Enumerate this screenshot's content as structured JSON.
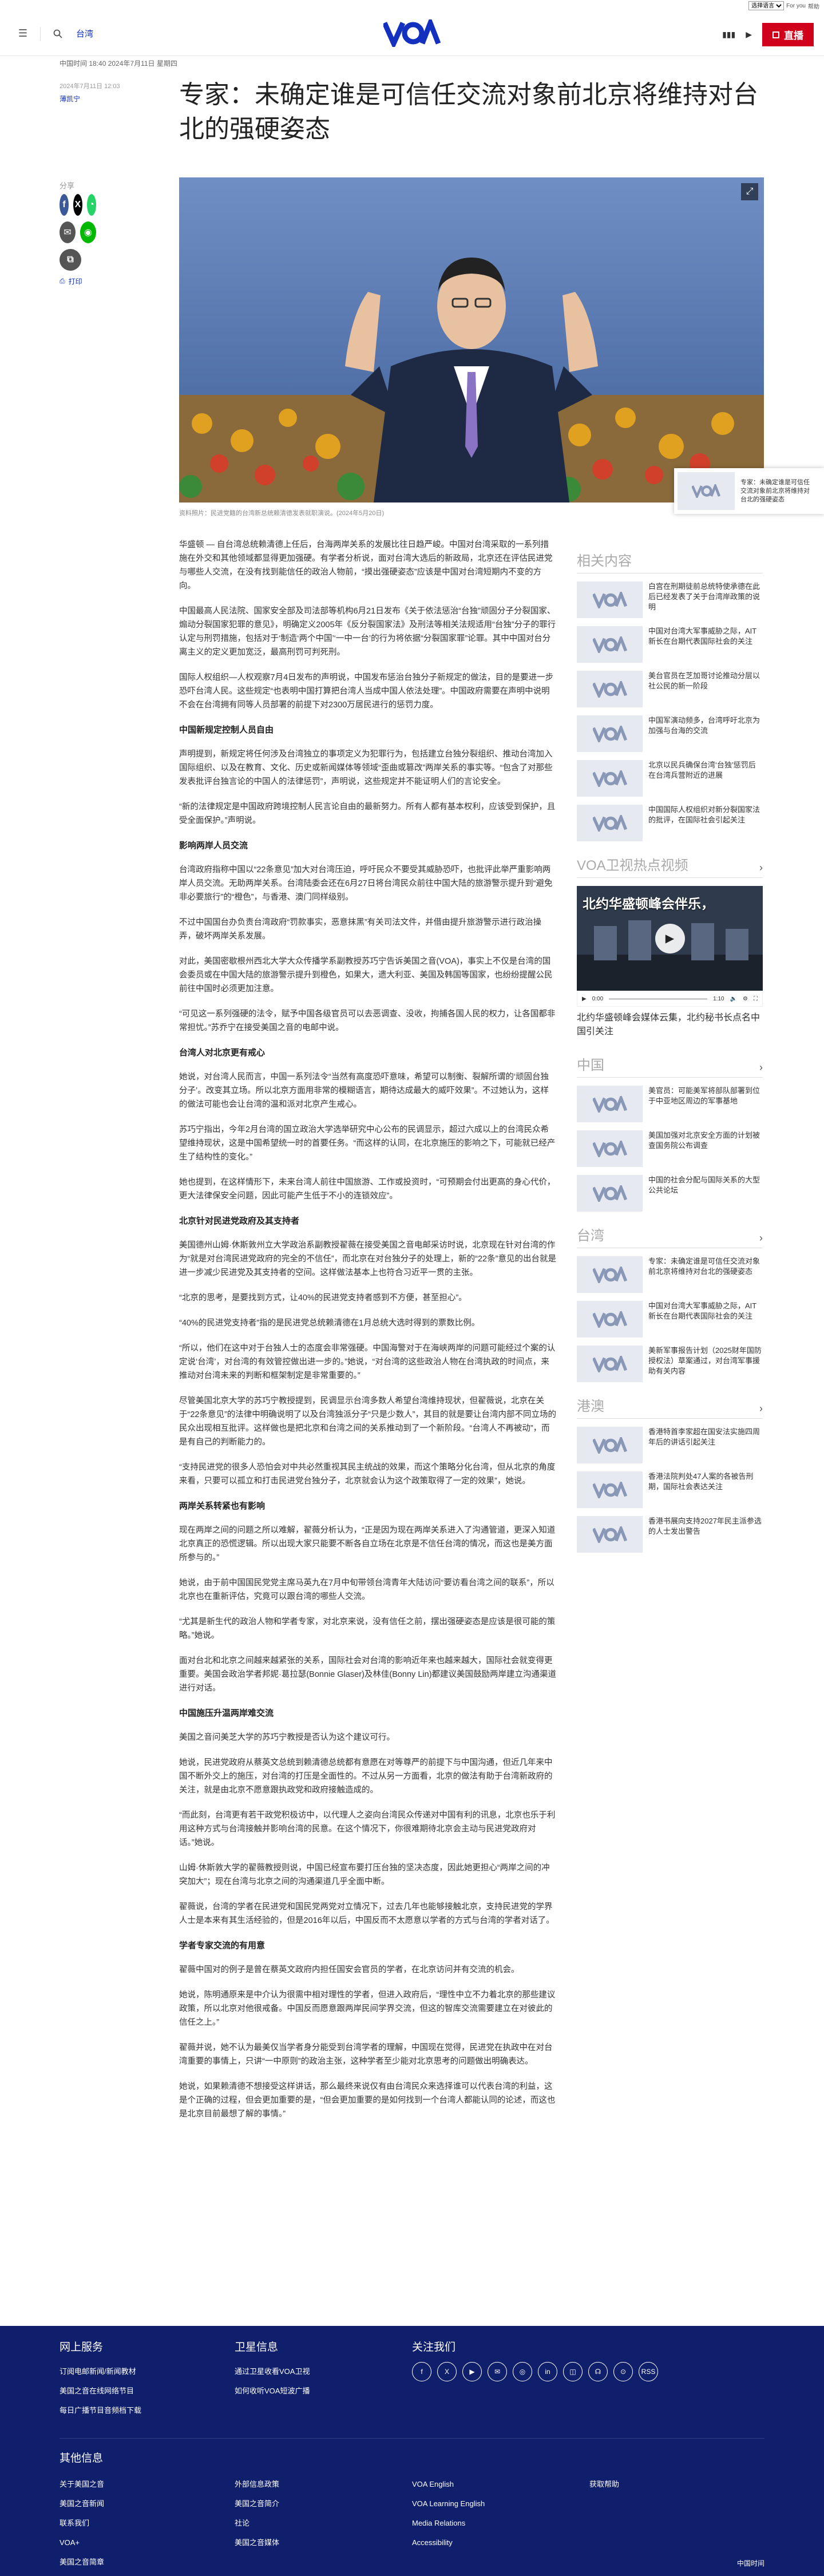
{
  "top_strip": {
    "select_value": "选择语言",
    "links": [
      "For you",
      "帮助"
    ]
  },
  "nav": {
    "section_link": "台湾",
    "logo_text": "VOA",
    "live_label": "直播"
  },
  "article": {
    "dateline": "中国时间 18:40 2024年7月11日 星期四",
    "timestamp": "2024年7月11日 12:03",
    "author": "薄凯宁",
    "title": "专家：未确定谁是可信任交流对象前北京将维持对台北的强硬姿态",
    "share_label": "分享",
    "print_label": "打印",
    "caption": "资料照片：民进党籍的台湾新总统赖清德发表就职演说。(2024年5月20日)",
    "paragraphs": [
      {
        "kind": "p",
        "text": "华盛顿 — 自台湾总统赖清德上任后，台海两岸关系的发展比往日趋严峻。中国对台湾采取的一系列措施在外交和其他领域都显得更加强硬。有学者分析说，面对台湾大选后的新政局，北京还在评估民进党与哪些人交流，在没有找到能信任的政治人物前，“摸出强硬姿态”应该是中国对台湾短期内不变的方向。"
      },
      {
        "kind": "p",
        "text": "中国最高人民法院、国家安全部及司法部等机构6月21日发布《关于依法惩治“台独”顽固分子分裂国家、煽动分裂国家犯罪的意见》，明确定义2005年《反分裂国家法》及刑法等相关法规适用“台独”分子的罪行认定与刑罚措施，包括对于‘制造‘两个中国’‘一中一台’的行为将依据“分裂国家罪”论罪。其中中国对台分离主义的定义更加宽泛，最高刑罚可判死刑。"
      },
      {
        "kind": "p",
        "text": "国际人权组织—人权观察7月4日发布的声明说，中国发布惩治台独分子新规定的做法，目的是要进一步恐吓台湾人民。这些规定“也表明中国打算把台湾人当成中国人依法处理”。中国政府需要在声明中说明不会在台湾拥有同等人员部署的前提下对2300万居民进行的惩罚力度。"
      },
      {
        "kind": "h",
        "text": "中国新规定控制人员自由"
      },
      {
        "kind": "p",
        "text": "声明提到，新规定将任何涉及台湾独立的事项定义为犯罪行为，包括建立台独分裂组织、推动台湾加入国际组织、以及在教育、文化、历史或新闻媒体等领域“歪曲或篡改”两岸关系的事实等。“包含了对那些发表批评台独言论的中国人的法律惩罚”，声明说，这些规定并不能证明人们的言论安全。"
      },
      {
        "kind": "p",
        "text": "“新的法律规定是中国政府跨境控制人民言论自由的最新努力。所有人都有基本权利，应该受到保护，且受全面保护。”声明说。"
      },
      {
        "kind": "h",
        "text": "影响两岸人员交流"
      },
      {
        "kind": "p",
        "text": "台湾政府指称中国以“22条意见”加大对台湾压迫，呼吁民众不要受其威胁恐吓，也批评此举严重影响两岸人员交流。无助两岸关系。台湾陆委会还在6月27日将台湾民众前往中国大陆的旅游警示提升到“避免非必要旅行”的“橙色”，与香港、澳门同样级别。"
      },
      {
        "kind": "p",
        "text": "不过中国国台办负责台湾政府“罚款事实，恶意抹黑”有关司法文件，并借由提升旅游警示进行政治操弄，破坏两岸关系发展。"
      },
      {
        "kind": "p",
        "text": "对此，美国密歇根州西北大学大众传播学系副教授苏巧宁告诉美国之音(VOA)，事实上不仅是台湾的国会委员或在中国大陆的旅游警示提升到橙色，如果大，遗大利亚、美国及韩国等国家，也纷纷提醒公民前往中国时必须更加注意。"
      },
      {
        "kind": "p",
        "text": "“可见这一系列强硬的法令，赋予中国各级官员可以去恶调查、没收，拘捕各国人民的权力，让各国都非常担忧。”苏乔宁在接受美国之音的电邮中说。"
      },
      {
        "kind": "h",
        "text": "台湾人对北京更有戒心"
      },
      {
        "kind": "p",
        "text": "她说，对台湾人民而言，中国一系列法令“当然有高度恐吓意味，希望可以制衡、裂解所谓的‘顽固台独分子’。改变其立场。所以北京方面用非常的模糊语言，期待达成最大的威吓效果”。不过她认为，这样的做法可能也会让台湾的温和派对北京产生戒心。"
      },
      {
        "kind": "p",
        "text": "苏巧宁指出，今年2月台湾的国立政治大学选举研究中心公布的民调显示，超过六成以上的台湾民众希望维持现状，这是中国希望统一时的首要任务。“而这样的认同，在北京施压的影响之下，可能就已经产生了结构性的变化。”"
      },
      {
        "kind": "p",
        "text": "她也提到，在这样情形下，未来台湾人前往中国旅游、工作或投资时，“可预期会付出更高的身心代价，更大法律保安全问题，因此可能产生低于不小的连锁效应”。"
      },
      {
        "kind": "h",
        "text": "北京针对民进党政府及其支持者"
      },
      {
        "kind": "p",
        "text": "美国德州山姆·休斯敦州立大学政治系副教授翟薇在接受美国之音电邮采访时说，北京现在针对台湾的作为“就是对台湾民进党政府的完全的不信任”，而北京在对台独分子的处理上，新的“22条”意见的出台就是进一步减少民进党及其支持者的空间。这样做法基本上也符合习近平一贯的主张。"
      },
      {
        "kind": "p",
        "text": "“北京的思考，是要找到方式，让40%的民进党支持者感到不方便，甚至担心”。"
      },
      {
        "kind": "p",
        "text": "“40%的民进党支持者”指的是民进党总统赖清德在1月总统大选时得到的票数比例。"
      },
      {
        "kind": "p",
        "text": "“所以，他们在这中对于台独人士的态度会非常强硬。中国海警对于在海峡两岸的问题可能经过个案的认定说‘台湾’，对台湾的有效管控做出进一步的。”她说，“对台湾的这些政治人物在台湾执政的时间点，来推动对台湾未来的判断和框架制定是非常重要的。”"
      },
      {
        "kind": "p",
        "text": "尽管美国北京大学的苏巧宁教授提到，民调显示台湾多数人希望台湾维持现状，但翟薇说，北京在关于“22条意见”的法律中明确说明了以及台湾独派分子“只是少数人”，其目的就是要让台湾内部不同立场的民众出现相互批评。这样做也是把北京和台湾之间的关系推动到了一个新阶段。“台湾人不再被动”，而是有自己的判断能力的。"
      },
      {
        "kind": "p",
        "text": "“支持民进党的很多人恐怕会对中共必然重视其民主统战的效果，而这个策略分化台湾，但从北京的角度来看，只要可以孤立和打击民进党台独分子，北京就会认为这个政策取得了一定的效果”，她说。"
      },
      {
        "kind": "h",
        "text": "两岸关系转紧也有影响"
      },
      {
        "kind": "p",
        "text": "现在两岸之间的问题之所以难解，翟薇分析认为，“正是因为现在两岸关系进入了沟通管道，更深入知道北京真正的恐慌逻辑。所以出现大家只能要不断各自立场在北京是不信任台湾的情况，而这也是美方面所参与的。”"
      },
      {
        "kind": "p",
        "text": "她说，由于前中国国民党党主席马英九在7月中旬带领台湾青年大陆访问“要访看台湾之间的联系”，所以北京也在重新评估，究竟可以跟台湾的哪些人交流。"
      },
      {
        "kind": "p",
        "text": "“尤其是新生代的政治人物和学者专家，对北京来说，没有信任之前，摆出强硬姿态是应该是很可能的策略。”她说。"
      },
      {
        "kind": "p",
        "text": "面对台北和北京之间越来越紧张的关系，国际社会对台湾的影响近年来也越来越大，国际社会就变得更重要。美国会政治学者邦妮·葛拉瑟(Bonnie Glaser)及林佳(Bonny Lin)都建议美国鼓励两岸建立沟通渠道进行对话。"
      },
      {
        "kind": "h",
        "text": "中国施压升温两岸难交流"
      },
      {
        "kind": "p",
        "text": "美国之音问美芝大学的苏巧宁教授是否认为这个建议可行。"
      },
      {
        "kind": "p",
        "text": "她说，民进党政府从蔡英文总统到赖清德总统都有意愿在对等尊严的前提下与中国沟通，但近几年来中国不断外交上的施压，对台湾的打压是全面性的。不过从另一方面看，北京的做法有助于台湾新政府的关注，就是由北京不愿意跟执政党和政府接触造成的。"
      },
      {
        "kind": "p",
        "text": "“而此刻，台湾更有若干政党积极访中，以代理人之姿向台湾民众传递对中国有利的讯息，北京也乐于利用这种方式与台湾接触并影响台湾的民意。在这个情况下，你很难期待北京会主动与民进党政府对话。”她说。"
      },
      {
        "kind": "p",
        "text": "山姆·休斯敦大学的翟薇教授则说，中国已经宣布要打压台独的坚决态度，因此她更担心“两岸之间的冲突加大”；现在台湾与北京之间的沟通渠道几乎全面中断。"
      },
      {
        "kind": "p",
        "text": "翟薇说，台湾的学者在民进党和国民党两党对立情况下，过去几年也能够接触北京，支持民进党的学界人士是本来有其生活经验的，但是2016年以后，中国反而不太愿意以学者的方式与台湾的学者对话了。"
      },
      {
        "kind": "h",
        "text": "学者专家交流的有用意"
      },
      {
        "kind": "p",
        "text": "翟薇中国对的例子是曾在蔡英文政府内担任国安会官员的学者，在北京访问并有交流的机会。"
      },
      {
        "kind": "p",
        "text": "她说，陈明通原来是中介认为很需中相对理性的学者，但进入政府后，“理性中立不力着北京的那些建议政策，所以北京对他很戒备。中国反而愿意跟两岸民间学界交流，但这的智库交流需要建立在对彼此的信任之上。”"
      },
      {
        "kind": "p",
        "text": "翟薇并说，她不认为最美仅当学者身分能受到台湾学者的理解，中国现在觉得，民进党在执政中在对台湾重要的事情上，只讲“一中原则”的政治主张，这种学者至少能对北京思考的问题做出明确表达。"
      },
      {
        "kind": "p",
        "text": "她说，如果赖清德不想接受这样讲话，那么最终来说仅有由台湾民众来选择谁可以代表台湾的利益，这是个正确的过程，但会更加重要的是，“但会更加重要的是如何找到一个台湾人都能认同的论述，而这也是北京目前最想了解的事情。”"
      }
    ]
  },
  "rail": {
    "related_heading": "相关内容",
    "related": [
      "白宫在刑期徒前总统特使承德在此后已经发表了关于台湾岸政策的说明",
      "中国对台湾大军事威胁之际，AIT新长在台期代表国际社会的关注",
      "美台官员在芝加哥讨论推动分层以社公民的新一阶段",
      "中国军演动频多，台湾呼吁北京为加强与台海的交流",
      "北京以民兵确保台湾‘台独’惩罚后在台湾兵营附近的进展",
      "中国国际人权组织对新分裂国家法的批评，在国际社会引起关注"
    ],
    "video_heading": "VOA卫视热点视频",
    "video_overlay": "北约华盛顿峰会伴乐，",
    "video_time": "0:00",
    "video_duration": "1:10",
    "video_title": "北约华盛顿峰会媒体云集，北约秘书长点名中国引关注",
    "china_heading": "中国",
    "china_items": [
      "美官员：可能美军将部队部署到位于中亚地区周边的军事基地",
      "美国加强对北京安全方面的计划被查国务院公布调查",
      "中国的社会分配与国际关系的大型公共论坛"
    ],
    "taiwan_heading": "台湾",
    "taiwan_items": [
      "专家：未确定谁是可信任交流对象前北京将维持对台北的强硬姿态",
      "中国对台湾大军事威胁之际，AIT新长在台期代表国际社会的关注",
      "美新军事报告计划（2025财年国防授权法）草案通过，对台湾军事援助有关内容"
    ],
    "hk_heading": "港澳",
    "hk_items": [
      "香港特首李家超在国安法实施四周年后的讲话引起关注",
      "香港法院判处47人案的各被告刑期，国际社会表达关注",
      "香港书展向支持2027年民主派参选的人士发出警告"
    ]
  },
  "sticky": {
    "text": "专家：未确定谁是可信任交流对象前北京将维持对台北的强硬姿态"
  },
  "footer": {
    "col1_heading": "网上服务",
    "col1_links": [
      "订阅电邮新闻/新闻教材",
      "美国之音在线网络节目",
      "每日广播节目音频档下载"
    ],
    "col2_heading": "卫星信息",
    "col2_links": [
      "通过卫星收看VOA卫视",
      "如何收听VOA短波广播"
    ],
    "col3_heading": "关注我们",
    "social": [
      "f",
      "X",
      "▶",
      "✉",
      "◎",
      "in",
      "◫",
      "☊",
      "⊙",
      "RSS"
    ],
    "other_heading": "其他信息",
    "other_links": [
      [
        "关于美国之音",
        "美国之音新闻",
        "联系我们",
        "VOA+",
        "美国之音简章"
      ],
      [
        "外部信息政策",
        "美国之音简介",
        "社论",
        "美国之音媒体"
      ],
      [
        "VOA English",
        "VOA Learning English",
        "Media Relations",
        "Accessibility"
      ],
      [
        "获取帮助"
      ]
    ],
    "copyright": "中国时间"
  },
  "colors": {
    "brand": "#1330bf",
    "live": "#d0021b",
    "footer_bg": "#0f1f6b"
  }
}
